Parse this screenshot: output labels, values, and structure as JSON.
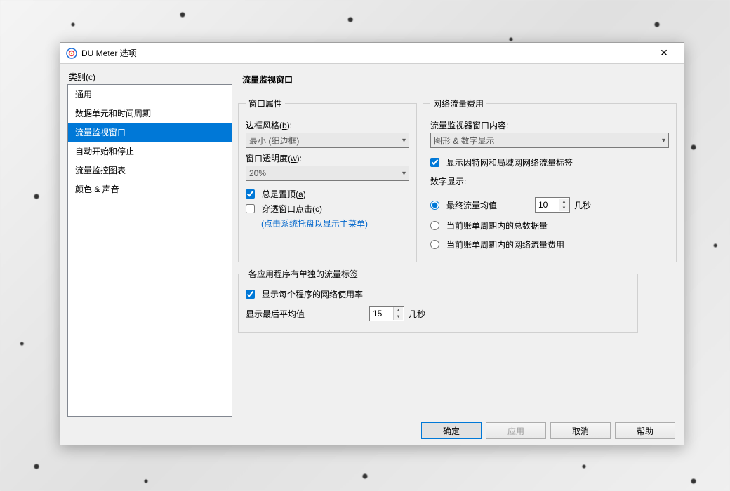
{
  "window": {
    "title": "DU Meter 选项"
  },
  "sidebar": {
    "label": "类别(c)",
    "items": [
      "通用",
      "数据单元和时间周期",
      "流量监视窗口",
      "自动开始和停止",
      "流量监控图表",
      "颜色 & 声音"
    ],
    "selected_index": 2
  },
  "content": {
    "title": "流量监视窗口",
    "window_props": {
      "legend": "窗口属性",
      "border_style_label": "边框风格(",
      "border_style_key": "b",
      "border_style_label2": "):",
      "border_style_value": "最小 (细边框)",
      "opacity_label": "窗口透明度(",
      "opacity_key": "w",
      "opacity_label2": "):",
      "opacity_value": "20%",
      "always_top_label": "总是置顶(",
      "always_top_key": "a",
      "always_top_label2": ")",
      "always_top_checked": true,
      "click_through_label": "穿透窗口点击(",
      "click_through_key": "c",
      "click_through_label2": ")",
      "click_through_checked": false,
      "click_through_hint": "(点击系统托盘以显示主菜单)"
    },
    "traffic_cost": {
      "legend": "网络流量费用",
      "monitor_content_label": "流量监视器窗口内容:",
      "monitor_content_value": "图形 & 数字显示",
      "show_labels_label": "显示因特网和局域网网络流量标签",
      "show_labels_checked": true,
      "digit_display_label": "数字显示:",
      "radio_final_avg": "最终流量均值",
      "radio_final_avg_value": "10",
      "radio_final_avg_unit": "几秒",
      "radio_total_data": "当前账单周期内的总数据量",
      "radio_cost": "当前账单周期内的网络流量费用",
      "radio_selected": 0
    },
    "per_app": {
      "legend": "各应用程序有单独的流量标签",
      "show_usage_label": "显示每个程序的网络使用率",
      "show_usage_checked": true,
      "last_avg_label": "显示最后平均值",
      "last_avg_value": "15",
      "last_avg_unit": "几秒"
    }
  },
  "footer": {
    "ok": "确定",
    "apply": "应用",
    "cancel": "取消",
    "help": "帮助"
  }
}
